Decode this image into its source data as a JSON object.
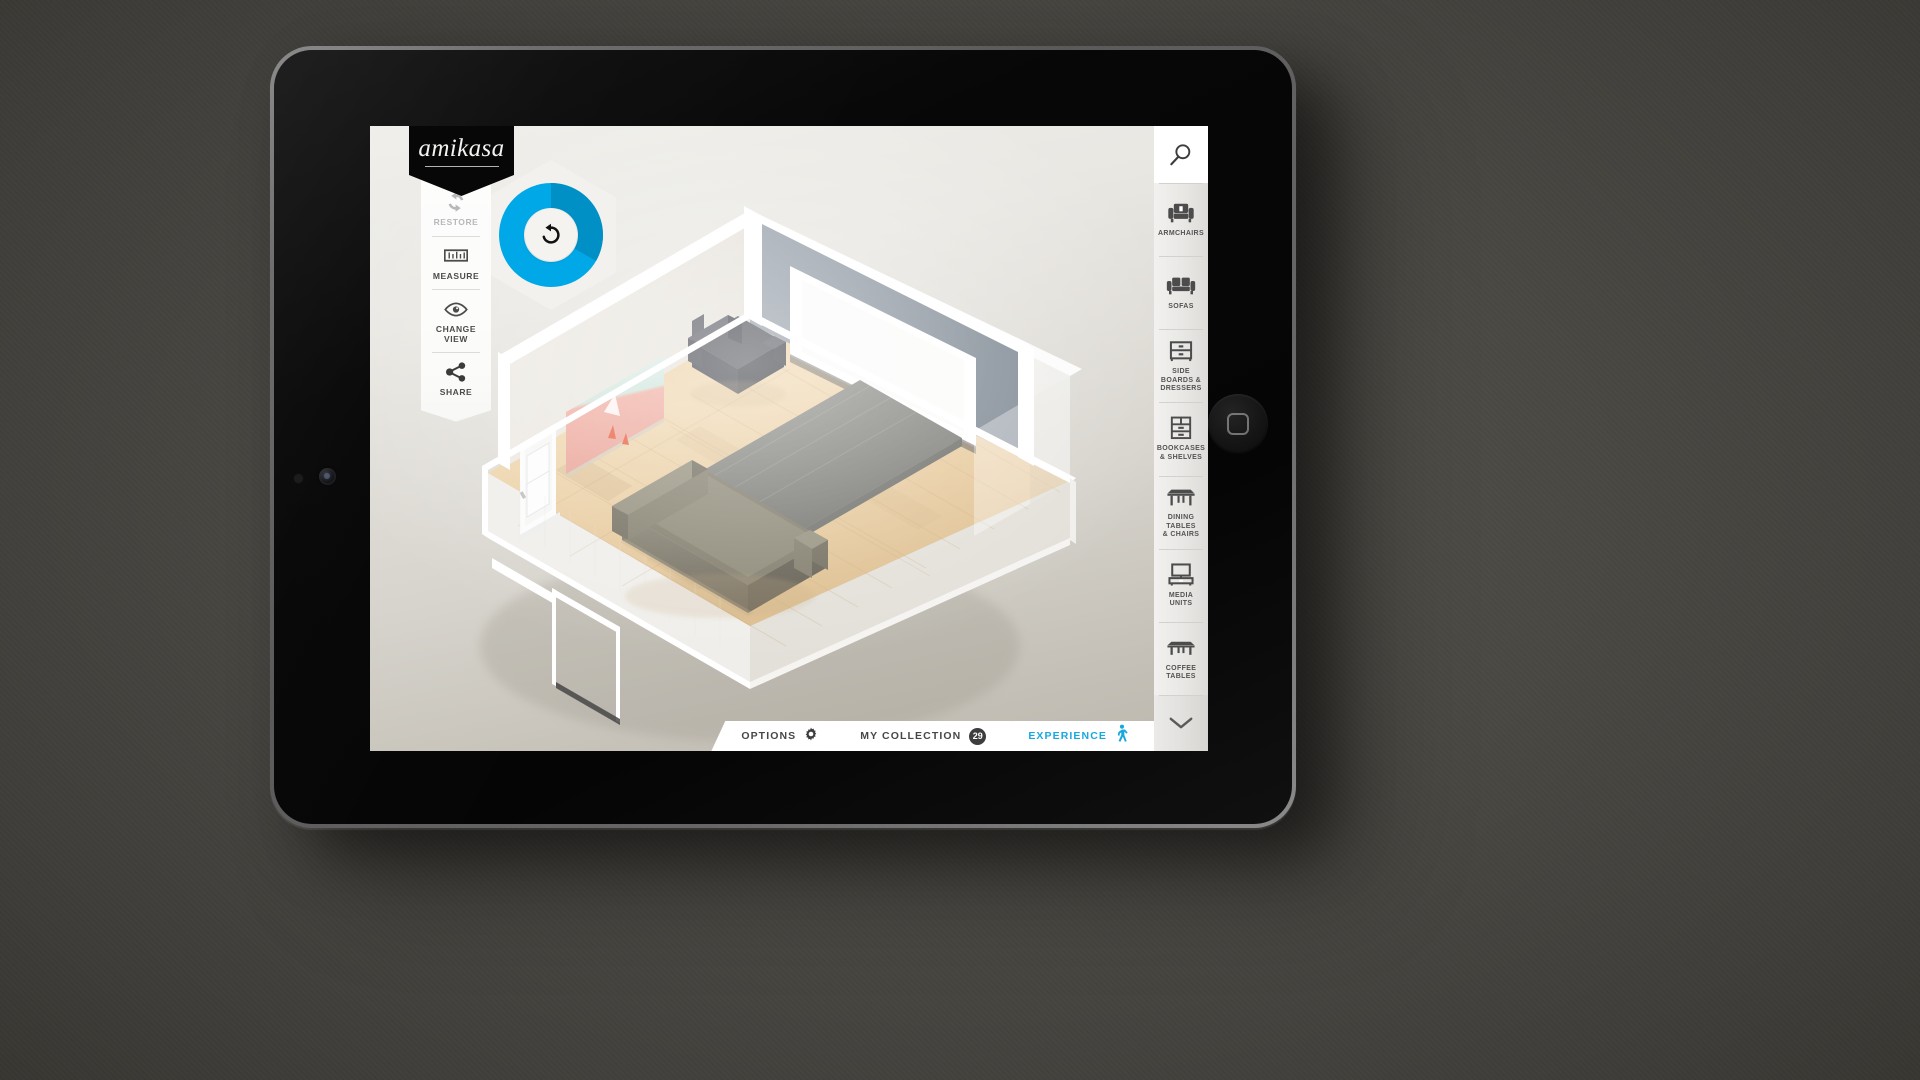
{
  "app": {
    "brand": "amikasa",
    "accent_color": "#18a8e0",
    "dark_color": "#0a0a0a"
  },
  "tools": {
    "items": [
      {
        "label": "RESTORE",
        "icon": "restore-icon",
        "disabled": true
      },
      {
        "label": "MEASURE",
        "icon": "ruler-icon",
        "disabled": false
      },
      {
        "label": "CHANGE\nVIEW",
        "line1": "CHANGE",
        "line2": "VIEW",
        "icon": "eye-icon",
        "disabled": false
      },
      {
        "label": "SHARE",
        "icon": "share-icon",
        "disabled": false
      }
    ]
  },
  "dial": {
    "name": "rotate-dial",
    "icon": "rotate-counterclockwise-icon",
    "ring_color": "#00a8e8",
    "segment_color": "#0091c8",
    "hub_color": "#f4f3f0"
  },
  "rail": {
    "search": {
      "label": "",
      "icon": "search-icon"
    },
    "categories": [
      {
        "lines": [
          "ARMCHAIRS"
        ],
        "icon": "armchair-icon"
      },
      {
        "lines": [
          "SOFAS"
        ],
        "icon": "sofa-icon"
      },
      {
        "lines": [
          "SIDE",
          "BOARDS &",
          "DRESSERS"
        ],
        "icon": "dresser-icon"
      },
      {
        "lines": [
          "BOOKCASES",
          "& SHELVES"
        ],
        "icon": "bookcase-icon"
      },
      {
        "lines": [
          "DINING",
          "TABLES",
          "& CHAIRS"
        ],
        "icon": "dining-table-icon"
      },
      {
        "lines": [
          "MEDIA",
          "UNITS"
        ],
        "icon": "media-unit-icon"
      },
      {
        "lines": [
          "COFFEE",
          "TABLES"
        ],
        "icon": "coffee-table-icon"
      }
    ],
    "more": {
      "icon": "chevron-down-icon"
    }
  },
  "bottom_tabs": [
    {
      "label": "OPTIONS",
      "icon": "gear-icon",
      "accent": false,
      "badge": null
    },
    {
      "label": "MY COLLECTION",
      "icon": null,
      "accent": false,
      "badge": "29"
    },
    {
      "label": "EXPERIENCE",
      "icon": "walking-person-icon",
      "accent": true,
      "badge": null
    }
  ],
  "scene": {
    "name": "3d-room-plan",
    "floor": "light oak parquet",
    "objects": [
      "armchair",
      "sofa",
      "area rug",
      "wall artwork",
      "door",
      "window",
      "accent wall"
    ]
  }
}
